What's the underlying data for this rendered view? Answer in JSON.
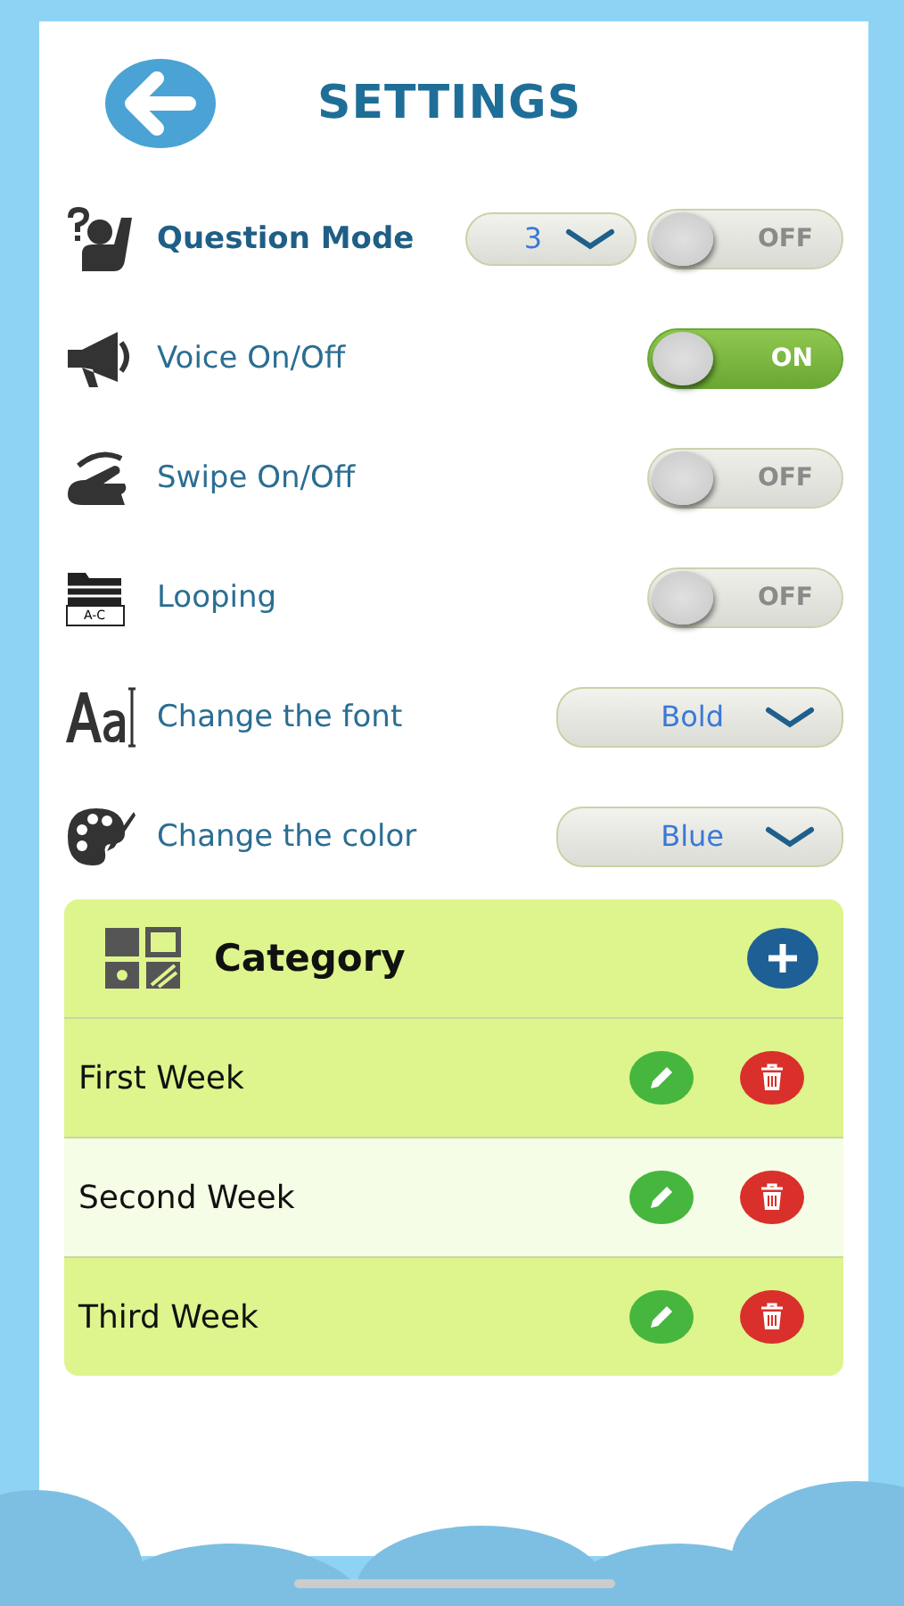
{
  "header": {
    "title": "SETTINGS"
  },
  "settings": [
    {
      "kind": "select-toggle",
      "label": "Question Mode",
      "bold": true,
      "select": {
        "value": "3"
      },
      "toggle": {
        "on": false,
        "text": "OFF"
      }
    },
    {
      "kind": "toggle",
      "label": "Voice On/Off",
      "bold": false,
      "toggle": {
        "on": true,
        "text": "ON"
      }
    },
    {
      "kind": "toggle",
      "label": "Swipe On/Off",
      "bold": false,
      "toggle": {
        "on": false,
        "text": "OFF"
      }
    },
    {
      "kind": "toggle",
      "icon_text": "A-C",
      "label": "Looping",
      "bold": false,
      "toggle": {
        "on": false,
        "text": "OFF"
      }
    },
    {
      "kind": "select",
      "label": "Change the font",
      "bold": false,
      "select": {
        "value": "Bold"
      }
    },
    {
      "kind": "select",
      "label": "Change the color",
      "bold": false,
      "select": {
        "value": "Blue"
      }
    }
  ],
  "category": {
    "title": "Category",
    "items": [
      {
        "name": "First Week",
        "selected": false
      },
      {
        "name": "Second Week",
        "selected": true
      },
      {
        "name": "Third Week",
        "selected": false
      }
    ]
  }
}
